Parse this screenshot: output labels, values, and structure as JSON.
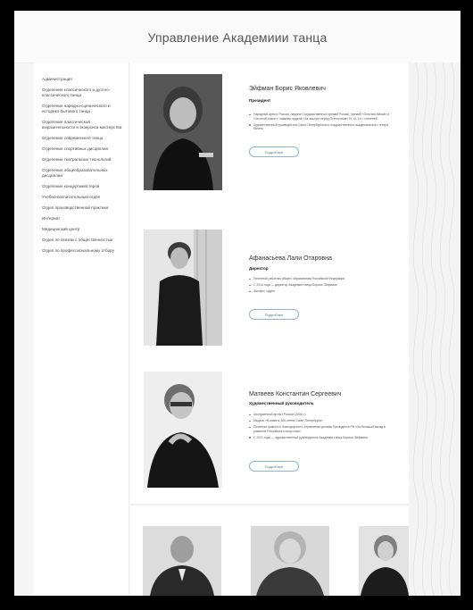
{
  "header": {
    "title": "Управление Академиии танца"
  },
  "sidebar": {
    "items": [
      "Администрация",
      "Отделение классического и дуэтно-классического танца",
      "Отделение народно-сценического и историко-бытового танца",
      "Отделение пластической выразительности и экзерсиса мастерства",
      "Отделение современного танца",
      "Отделение спортивных дисциплин",
      "Отделение театральных технологий",
      "Отделение общеобразовательных дисциплин",
      "Отделение концертмейстеров",
      "Учебно-воспитательный отдел",
      "Отдел производственной практики",
      "Интернат",
      "Медицинский центр",
      "Отдел по связям с общественностью",
      "Отдел по профессиональному отбору"
    ]
  },
  "people": [
    {
      "name": "Эйфман Борис Яковлевич",
      "role": "Президент",
      "bullets": [
        "Народный артист России, лауреат Государственных премий России, премий «Золотая Маска» и «Золотой софит», кавалер ордена «За заслуги перед Отечеством» IV, III, II и I степеней",
        "Художественный руководитель Санкт-Петербургского государственного академического театра балета"
      ],
      "button": "Подробнее"
    },
    {
      "name": "Афанасьева Лали Отаровна",
      "role": "Директор",
      "bullets": [
        "Почетный работник общего образования Российской Федерации",
        "С 2013 года — директор Академии танца Бориса Эйфмана",
        "Заслуги: орден"
      ],
      "button": "Подробнее"
    },
    {
      "name": "Матвеев Константин Сергеевич",
      "role": "Художественный руководитель",
      "bullets": [
        "Заслуженный артист России (2006 г.)",
        "Медаль «В память 300-летия Санкт-Петербурга»",
        "Почетная грамота и благодарность Управления делами Президента РФ «За большой вклад в развитие Российского искусства»",
        "С 2021 года — художественный руководитель Академии танца Бориса Эйфмана"
      ],
      "button": "Подробнее"
    }
  ]
}
